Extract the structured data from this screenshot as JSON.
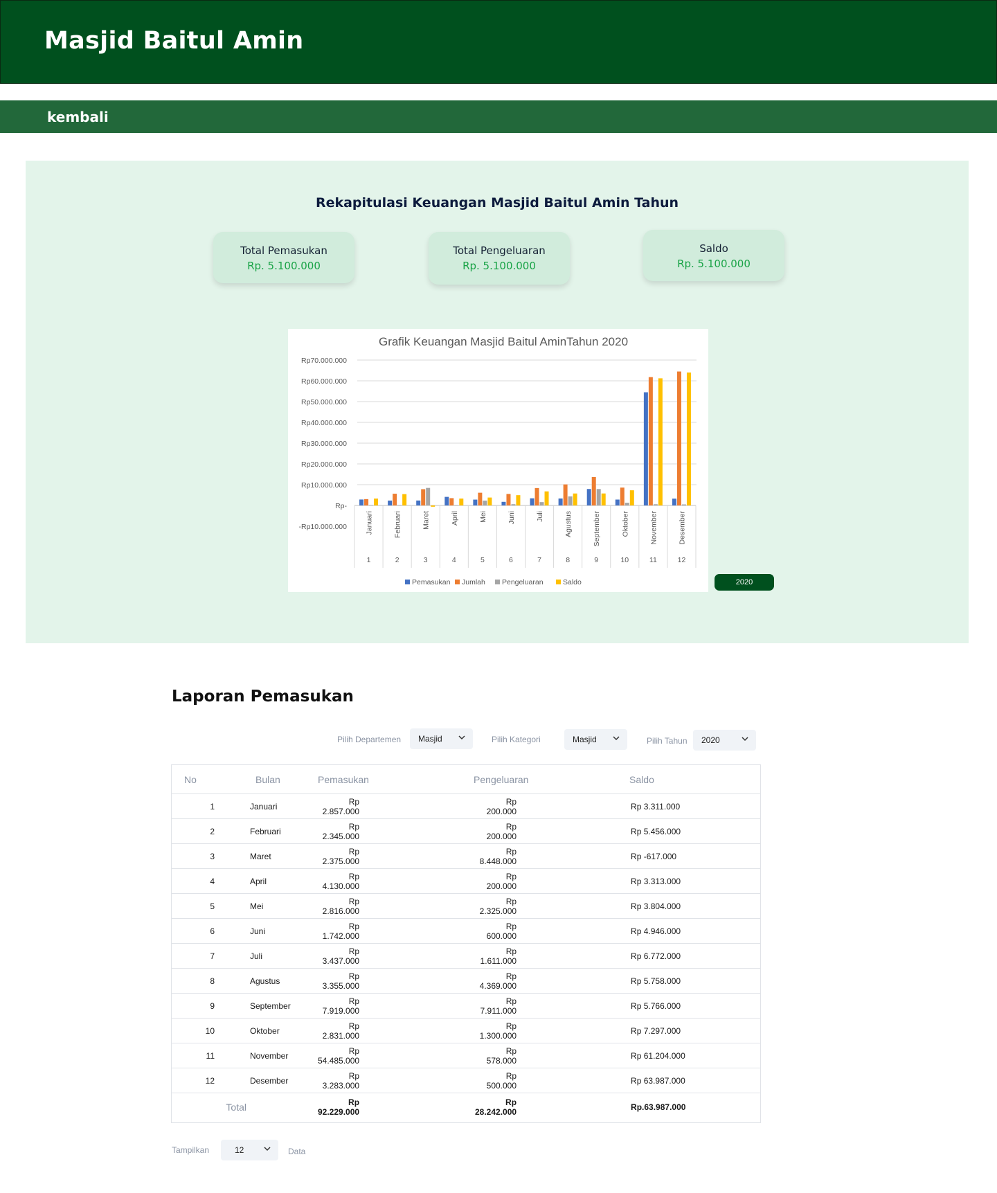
{
  "app": {
    "title": "Masjid Baitul Amin"
  },
  "nav": {
    "back_label": "kembali"
  },
  "recap": {
    "title": "Rekapitulasi Keuangan Masjid Baitul Amin Tahun",
    "cards": [
      {
        "label": "Total Pemasukan",
        "value": "Rp. 5.100.000"
      },
      {
        "label": "Total Pengeluaran",
        "value": "Rp. 5.100.000"
      },
      {
        "label": "Saldo",
        "value": "Rp. 5.100.000"
      }
    ],
    "year_button": "2020"
  },
  "chart_data": {
    "type": "bar",
    "title": "Grafik Keuangan Masjid Baitul AminTahun 2020",
    "categories": [
      "Januari",
      "Februari",
      "Maret",
      "April",
      "Mei",
      "Juni",
      "Juli",
      "Agustus",
      "September",
      "Oktober",
      "November",
      "Desember"
    ],
    "category_numbers": [
      "1",
      "2",
      "3",
      "4",
      "5",
      "6",
      "7",
      "8",
      "9",
      "10",
      "11",
      "12"
    ],
    "yticks": [
      "Rp70.000.000",
      "Rp60.000.000",
      "Rp50.000.000",
      "Rp40.000.000",
      "Rp30.000.000",
      "Rp20.000.000",
      "Rp10.000.000",
      "Rp-",
      "-Rp10.000.000"
    ],
    "ylim": [
      -10000000,
      70000000
    ],
    "grid": true,
    "legend_position": "bottom",
    "series": [
      {
        "name": "Pemasukan",
        "color": "#4472c4",
        "values": [
          2857000,
          2345000,
          2375000,
          4130000,
          2816000,
          1742000,
          3437000,
          3355000,
          7919000,
          2831000,
          54485000,
          3283000
        ]
      },
      {
        "name": "Jumlah",
        "color": "#ed7d31",
        "values": [
          3057000,
          5656000,
          7829000,
          3513000,
          6129000,
          5546000,
          8383000,
          10127000,
          13685000,
          8597000,
          61782000,
          64487000
        ]
      },
      {
        "name": "Pengeluaran",
        "color": "#a5a5a5",
        "values": [
          200000,
          200000,
          8448000,
          200000,
          2325000,
          600000,
          1611000,
          4369000,
          7911000,
          1300000,
          578000,
          500000
        ]
      },
      {
        "name": "Saldo",
        "color": "#ffc000",
        "values": [
          3311000,
          5456000,
          -617000,
          3313000,
          3804000,
          4946000,
          6772000,
          5758000,
          5766000,
          7297000,
          61204000,
          63987000
        ]
      }
    ]
  },
  "report": {
    "title": "Laporan Pemasukan",
    "filters": {
      "dept_label": "Pilih Departemen",
      "dept_value": "Masjid",
      "cat_label": "Pilih Kategori",
      "cat_value": "Masjid",
      "year_label": "Pilih Tahun",
      "year_value": "2020"
    },
    "columns": [
      "No",
      "Bulan",
      "Pemasukan",
      "Pengeluaran",
      "Saldo"
    ],
    "rows": [
      [
        "1",
        "Januari",
        "Rp 2.857.000",
        "Rp 200.000",
        "Rp 3.311.000"
      ],
      [
        "2",
        "Februari",
        "Rp 2.345.000",
        "Rp 200.000",
        "Rp 5.456.000"
      ],
      [
        "3",
        "Maret",
        "Rp 2.375.000",
        "Rp 8.448.000",
        "Rp -617.000"
      ],
      [
        "4",
        "April",
        "Rp 4.130.000",
        "Rp 200.000",
        "Rp 3.313.000"
      ],
      [
        "5",
        "Mei",
        "Rp 2.816.000",
        "Rp 2.325.000",
        "Rp 3.804.000"
      ],
      [
        "6",
        "Juni",
        "Rp 1.742.000",
        "Rp 600.000",
        "Rp 4.946.000"
      ],
      [
        "7",
        "Juli",
        "Rp 3.437.000",
        "Rp 1.611.000",
        "Rp 6.772.000"
      ],
      [
        "8",
        "Agustus",
        "Rp 3.355.000",
        "Rp 4.369.000",
        "Rp 5.758.000"
      ],
      [
        "9",
        "September",
        "Rp 7.919.000",
        "Rp 7.911.000",
        "Rp 5.766.000"
      ],
      [
        "10",
        "Oktober",
        "Rp 2.831.000",
        "Rp 1.300.000",
        "Rp 7.297.000"
      ],
      [
        "11",
        "November",
        "Rp 54.485.000",
        "Rp 578.000",
        "Rp 61.204.000"
      ],
      [
        "12",
        "Desember",
        "Rp 3.283.000",
        "Rp 500.000",
        "Rp 63.987.000"
      ]
    ],
    "total": {
      "label": "Total",
      "pemasukan": "Rp 92.229.000",
      "pengeluaran": "Rp 28.242.000",
      "saldo": "Rp.63.987.000"
    },
    "pagination": {
      "show_label": "Tampilkan",
      "show_value": "12",
      "data_label": "Data"
    }
  }
}
